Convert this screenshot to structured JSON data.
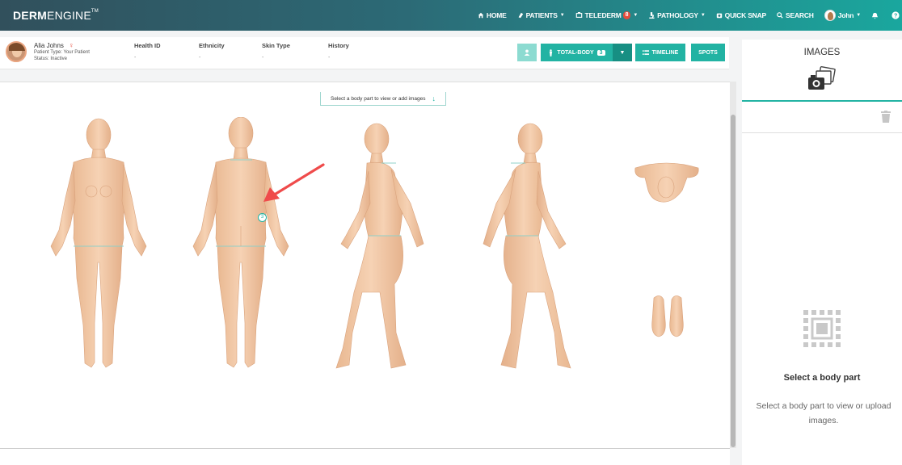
{
  "brand": {
    "name_bold": "DERM",
    "name_light": "ENGINE",
    "tm": "TM"
  },
  "nav": {
    "home": "HOME",
    "patients": "PATIENTS",
    "telederm": "TELEDERM",
    "telederm_badge": "8",
    "pathology": "PATHOLOGY",
    "quick_snap": "QUICK SNAP",
    "search": "SEARCH",
    "user": "John"
  },
  "patient": {
    "name": "Alia Johns",
    "gender_symbol": "♀",
    "type": "Patient Type: Your Patient",
    "status": "Status: Inactive",
    "columns": [
      {
        "label": "Health ID",
        "value": "-"
      },
      {
        "label": "Ethnicity",
        "value": "-"
      },
      {
        "label": "Skin Type",
        "value": "-"
      },
      {
        "label": "History",
        "value": "-"
      }
    ]
  },
  "toolbar": {
    "total_body": "TOTAL-BODY",
    "total_body_count": "3",
    "timeline": "TIMELINE",
    "spots": "SPOTS"
  },
  "canvas": {
    "hint": "Select a body part to view or add images",
    "marker_count": "3"
  },
  "panel": {
    "title": "IMAGES",
    "empty_title": "Select a body part",
    "empty_text": "Select a body part to view or upload images."
  },
  "colors": {
    "accent": "#22b3a3",
    "skin": "#f2c9a6",
    "annotation_arrow": "#ef4b4b"
  }
}
